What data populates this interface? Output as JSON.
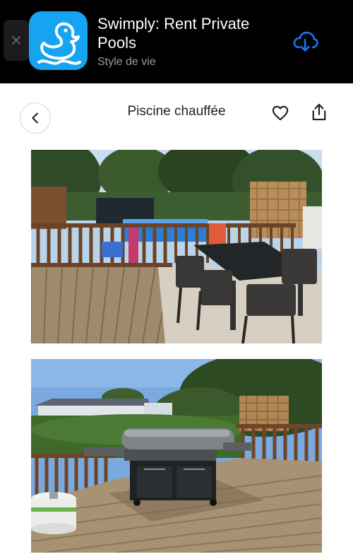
{
  "banner": {
    "app_name": "Swimply: Rent Private Pools",
    "category": "Style de vie",
    "close_icon": "close-icon",
    "download_icon": "cloud-download-icon",
    "icon_color": "#16a3f2"
  },
  "header": {
    "title": "Piscine chauffée",
    "back_icon": "chevron-left-icon",
    "favorite_icon": "heart-icon",
    "share_icon": "share-icon"
  },
  "photos": [
    {
      "subject": "pool-deck-with-dining-table"
    },
    {
      "subject": "deck-with-barbecue-grill"
    }
  ],
  "colors": {
    "accent": "#1a73e8",
    "banner_bg": "#000000",
    "text_primary": "#222222"
  }
}
